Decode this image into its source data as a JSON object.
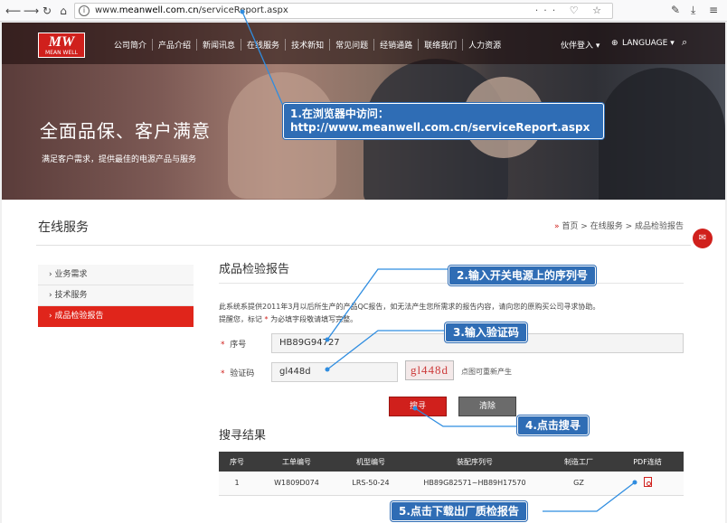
{
  "browser": {
    "url_prefix": "www.",
    "url_domain": "meanwell.com.cn",
    "url_path": "/serviceReport.aspx",
    "right_icons": "··· ♡ ☆",
    "tools": [
      "✎",
      "⤓",
      "≡"
    ]
  },
  "header": {
    "logo_mw": "MW",
    "logo_text": "MEAN WELL",
    "menu": [
      "公司简介",
      "产品介绍",
      "新闻讯息",
      "在线服务",
      "技术新知",
      "常见问题",
      "经销通路",
      "联络我们",
      "人力资源"
    ],
    "partner_login": "伙伴登入 ▾",
    "language": "LANGUAGE ▾",
    "search_icon": "⌕"
  },
  "banner": {
    "title": "全面品保、客户满意",
    "subtitle": "满足客户需求，提供最佳的电源产品与服务"
  },
  "page": {
    "section_title": "在线服务",
    "breadcrumb": {
      "arrow": "»",
      "home": "首页",
      "service": "在线服务",
      "current": "成品检验报告"
    },
    "sidebar": [
      {
        "label": "›  业务需求"
      },
      {
        "label": "›  技术服务"
      },
      {
        "label": "›  成品检验报告"
      }
    ],
    "main_title": "成品检验报告",
    "desc_line1": "此系统系提供2011年3月以后所生产的产品QC报告，如无法产生您所需求的报告内容，请向您的原购买公司寻求协助。",
    "desc_line2_a": "提醒您，标记",
    "desc_line2_star": " * ",
    "desc_line2_b": "为必填字段敬请填写完整。",
    "serial_label": "序号",
    "serial_value": "HB89G94727",
    "captcha_label": "验证码",
    "captcha_value": "gl448d",
    "captcha_image_text": "gl448d",
    "captcha_note": "点图可重新产生",
    "search_btn": "搜寻",
    "clear_btn": "清除",
    "results_title": "搜寻结果",
    "table": {
      "headers": [
        "序号",
        "工单编号",
        "机型编号",
        "装配序列号",
        "制造工厂",
        "PDF连结"
      ],
      "rows": [
        [
          "1",
          "W1809D074",
          "LRS-50-24",
          "HB89G82571~HB89H17570",
          "GZ"
        ]
      ]
    },
    "chat_icon": "✉"
  },
  "callouts": {
    "c1_line1": "1.在浏览器中访问：",
    "c1_line2": "http://www.meanwell.com.cn/serviceReport.aspx",
    "c2": "2.输入开关电源上的序列号",
    "c3": "3.输入验证码",
    "c4": "4.点击搜寻",
    "c5": "5.点击下载出厂质检报告"
  },
  "colors": {
    "accent_red": "#d0201c",
    "callout_blue": "#2f6db5"
  }
}
